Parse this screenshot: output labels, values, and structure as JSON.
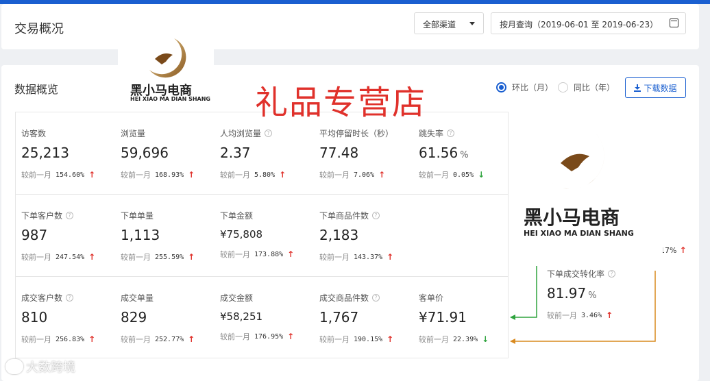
{
  "header": {
    "title": "交易概况",
    "channel_select": "全部渠道",
    "date_range": "按月查询（2019-06-01 至 2019-06-23）"
  },
  "overview": {
    "title": "数据概览",
    "radio_mom": "环比（月）",
    "radio_yoy": "同比（年）",
    "download_label": "下载数据",
    "compare_label": "较前一月"
  },
  "overlay": {
    "store_name": "礼品专营店",
    "logo_cn": "黑小马电商",
    "logo_en": "HEI XIAO MA DIAN SHANG",
    "watermark": "大数跨境"
  },
  "metrics": [
    {
      "label": "访客数",
      "value": "25,213",
      "unit": "",
      "change": "154.60%",
      "dir": "up",
      "help": false
    },
    {
      "label": "浏览量",
      "value": "59,696",
      "unit": "",
      "change": "168.93%",
      "dir": "up",
      "help": false
    },
    {
      "label": "人均浏览量",
      "value": "2.37",
      "unit": "",
      "change": "5.80%",
      "dir": "up",
      "help": true
    },
    {
      "label": "平均停留时长（秒）",
      "value": "77.48",
      "unit": "",
      "change": "7.06%",
      "dir": "up",
      "help": false
    },
    {
      "label": "跳失率",
      "value": "61.56",
      "unit": "%",
      "change": "0.05%",
      "dir": "down",
      "help": true
    },
    {
      "label": "下单客户数",
      "value": "987",
      "unit": "",
      "change": "247.54%",
      "dir": "up",
      "help": true
    },
    {
      "label": "下单单量",
      "value": "1,113",
      "unit": "",
      "change": "255.59%",
      "dir": "up",
      "help": false
    },
    {
      "label": "下单金额",
      "value": "¥75,808",
      "unit": "",
      "change": "173.88%",
      "dir": "up",
      "help": false
    },
    {
      "label": "下单商品件数",
      "value": "2,183",
      "unit": "",
      "change": "143.37%",
      "dir": "up",
      "help": true
    },
    {
      "label": "成交客户数",
      "value": "810",
      "unit": "",
      "change": "256.83%",
      "dir": "up",
      "help": true
    },
    {
      "label": "成交单量",
      "value": "829",
      "unit": "",
      "change": "252.77%",
      "dir": "up",
      "help": false
    },
    {
      "label": "成交金额",
      "value": "¥58,251",
      "unit": "",
      "change": "176.95%",
      "dir": "up",
      "help": false
    },
    {
      "label": "成交商品件数",
      "value": "1,767",
      "unit": "",
      "change": "190.15%",
      "dir": "up",
      "help": true
    },
    {
      "label": "客单价",
      "value": "¥71.91",
      "unit": "",
      "change": "22.39%",
      "dir": "down",
      "help": false
    }
  ],
  "conversion": {
    "label": "下单成交转化率",
    "value": "81.97",
    "unit": "%",
    "change": "3.46%",
    "dir": "up",
    "partial_change": "17%"
  },
  "colors": {
    "accent": "#1a5fd0",
    "up": "#e0312b",
    "down": "#2ea33d",
    "arrow_green": "#2ea33d",
    "arrow_orange": "#d98a1f"
  }
}
